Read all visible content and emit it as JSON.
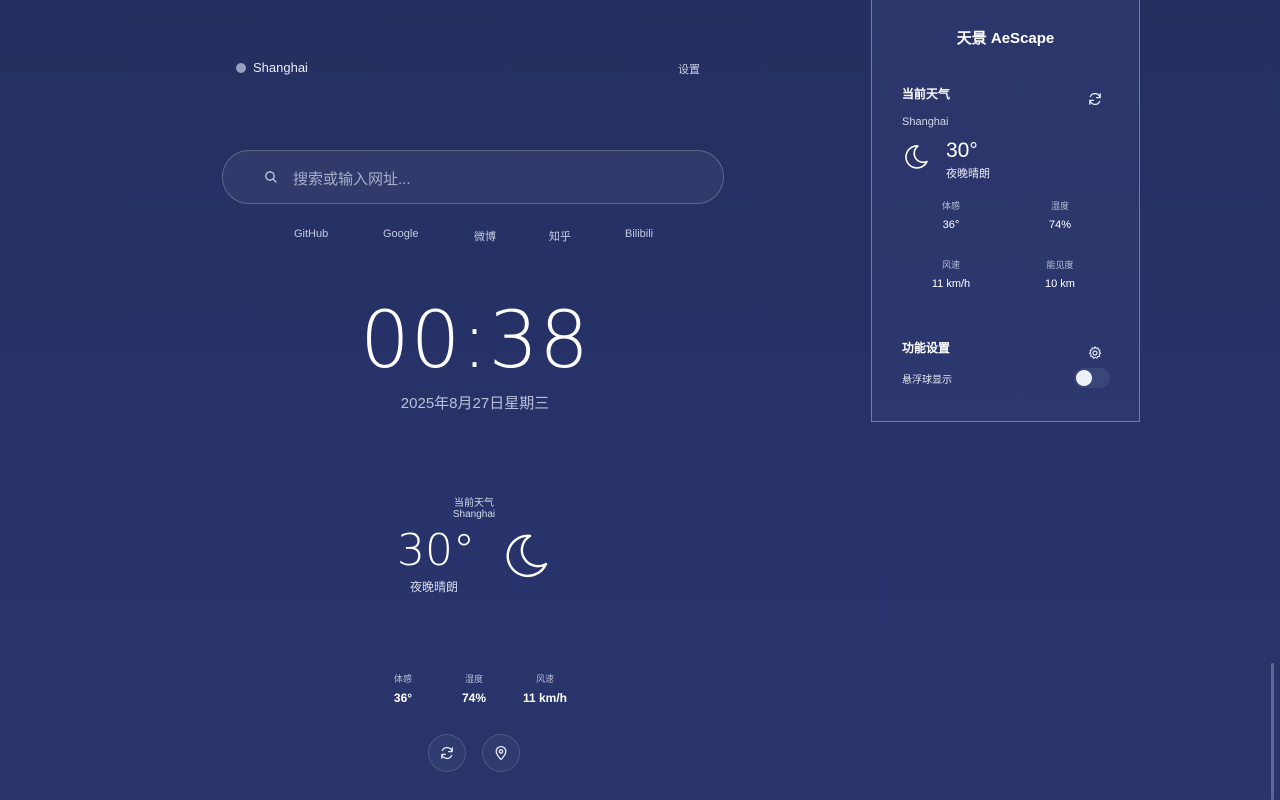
{
  "header": {
    "location": "Shanghai",
    "settings_label": "设置"
  },
  "search": {
    "placeholder": "搜索或输入网址...",
    "quick_links": [
      "GitHub",
      "Google",
      "微博",
      "知乎",
      "Bilibili"
    ]
  },
  "clock": {
    "time": "00:38",
    "date": "2025年8月27日星期三"
  },
  "main_weather": {
    "title": "当前天气",
    "city": "Shanghai",
    "temperature": "30°",
    "condition": "夜晚晴朗",
    "icon": "moon-icon",
    "stats": [
      {
        "label": "体感",
        "value": "36°"
      },
      {
        "label": "湿度",
        "value": "74%"
      },
      {
        "label": "风速",
        "value": "11 km/h"
      }
    ],
    "refresh_icon": "refresh-icon",
    "location_icon": "location-pin-icon"
  },
  "panel": {
    "title": "天景 AeScape",
    "weather_section": {
      "heading": "当前天气",
      "city": "Shanghai",
      "temperature": "30°",
      "condition": "夜晚晴朗",
      "icon": "moon-icon",
      "stats": [
        {
          "label": "体感",
          "value": "36°"
        },
        {
          "label": "湿度",
          "value": "74%"
        },
        {
          "label": "风速",
          "value": "11 km/h"
        },
        {
          "label": "能见度",
          "value": "10 km"
        }
      ]
    },
    "features_section": {
      "heading": "功能设置",
      "floating_ball_label": "悬浮球显示",
      "floating_ball_enabled": false
    }
  },
  "colors": {
    "background": "#25305f",
    "text": "#ffffff",
    "muted": "#b6bcd4"
  }
}
